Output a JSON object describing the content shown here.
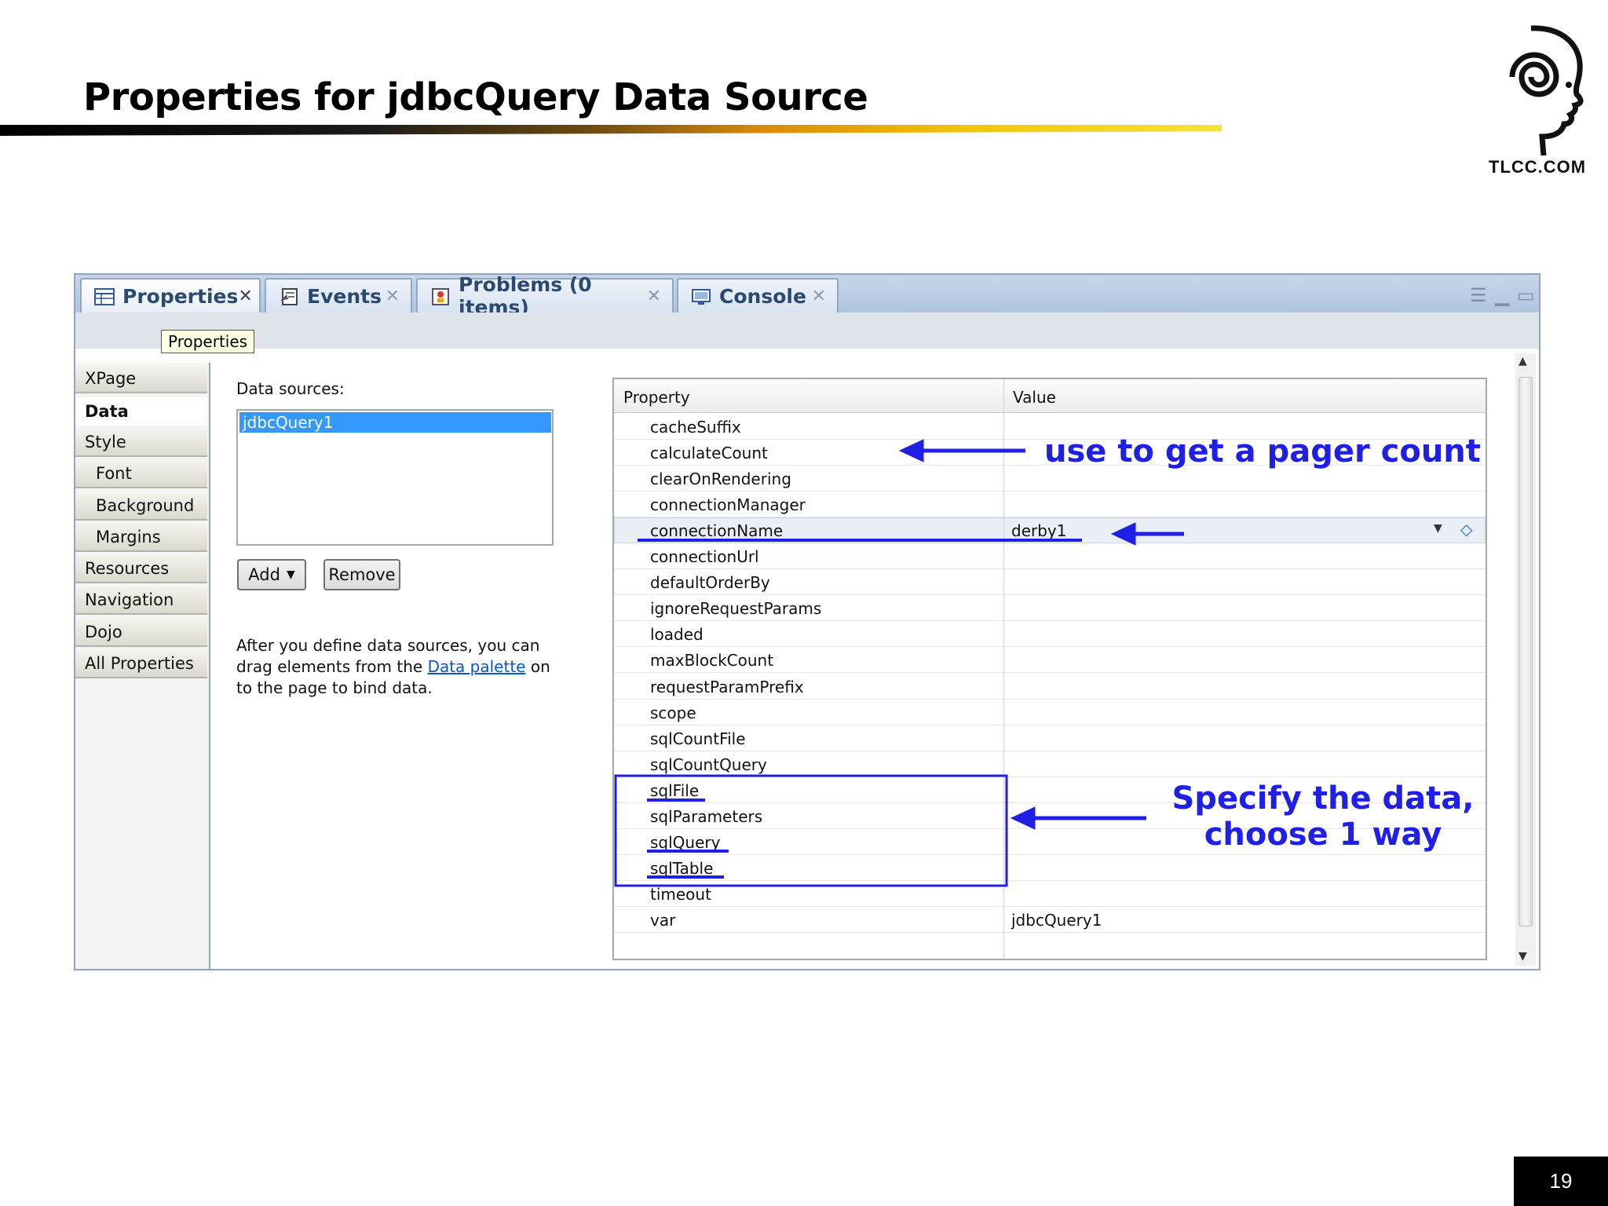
{
  "slide": {
    "title": "Properties for jdbcQuery Data Source",
    "logo_text": "TLCC.COM",
    "page_number": "19"
  },
  "tabs": [
    {
      "label": "Properties",
      "icon": "table-icon",
      "active": true
    },
    {
      "label": "Events",
      "icon": "events-icon",
      "active": false
    },
    {
      "label": "Problems (0 items)",
      "icon": "problems-icon",
      "active": false
    },
    {
      "label": "Console",
      "icon": "console-icon",
      "active": false
    }
  ],
  "tooltip": "Properties",
  "sidebar": {
    "items": [
      {
        "label": "XPage"
      },
      {
        "label": "Data",
        "selected": true
      },
      {
        "label": "Style"
      },
      {
        "label": "Font"
      },
      {
        "label": "Background"
      },
      {
        "label": "Margins"
      },
      {
        "label": "Resources"
      },
      {
        "label": "Navigation"
      },
      {
        "label": "Dojo"
      },
      {
        "label": "All Properties"
      }
    ]
  },
  "data_sources": {
    "label": "Data sources:",
    "items": [
      "jdbcQuery1"
    ],
    "add_label": "Add",
    "remove_label": "Remove",
    "help_before": "After you define data sources, you can drag elements from the ",
    "help_link": "Data palette",
    "help_after": " on to the page to bind data."
  },
  "property_table": {
    "headers": {
      "property": "Property",
      "value": "Value"
    },
    "rows": [
      {
        "name": "cacheSuffix",
        "value": ""
      },
      {
        "name": "calculateCount",
        "value": ""
      },
      {
        "name": "clearOnRendering",
        "value": ""
      },
      {
        "name": "connectionManager",
        "value": ""
      },
      {
        "name": "connectionName",
        "value": "derby1"
      },
      {
        "name": "connectionUrl",
        "value": ""
      },
      {
        "name": "defaultOrderBy",
        "value": ""
      },
      {
        "name": "ignoreRequestParams",
        "value": ""
      },
      {
        "name": "loaded",
        "value": ""
      },
      {
        "name": "maxBlockCount",
        "value": ""
      },
      {
        "name": "requestParamPrefix",
        "value": ""
      },
      {
        "name": "scope",
        "value": ""
      },
      {
        "name": "sqlCountFile",
        "value": ""
      },
      {
        "name": "sqlCountQuery",
        "value": ""
      },
      {
        "name": "sqlFile",
        "value": ""
      },
      {
        "name": "sqlParameters",
        "value": ""
      },
      {
        "name": "sqlQuery",
        "value": ""
      },
      {
        "name": "sqlTable",
        "value": ""
      },
      {
        "name": "timeout",
        "value": ""
      },
      {
        "name": "var",
        "value": "jdbcQuery1"
      }
    ]
  },
  "annotations": {
    "pager_note": "use to get a pager count",
    "specify_line1": "Specify the data,",
    "specify_line2": "choose 1 way",
    "color": "#1f1fe6"
  }
}
